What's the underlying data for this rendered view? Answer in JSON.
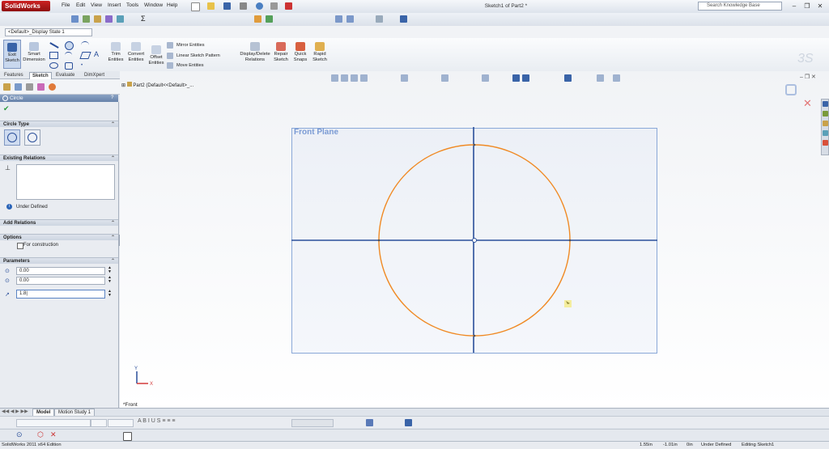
{
  "app": {
    "logo": "SolidWorks",
    "doc_title": "Sketch1 of Part2 *"
  },
  "menu": [
    "File",
    "Edit",
    "View",
    "Insert",
    "Tools",
    "Window",
    "Help"
  ],
  "search": {
    "placeholder": "Search Knowledge Base"
  },
  "config": {
    "display_state": "<Default>_Display State 1"
  },
  "commands": {
    "exit_sketch": [
      "Exit",
      "Sketch"
    ],
    "smart_dimension": [
      "Smart",
      "Dimension"
    ],
    "trim": [
      "Trim",
      "Entities"
    ],
    "convert": [
      "Convert",
      "Entities"
    ],
    "offset": [
      "Offset",
      "Entities"
    ],
    "mirror": "Mirror Entities",
    "linear_pattern": "Linear Sketch Pattern",
    "move": "Move Entities",
    "display_delete": [
      "Display/Delete",
      "Relations"
    ],
    "repair": [
      "Repair",
      "Sketch"
    ],
    "quick_snaps": [
      "Quick",
      "Snaps"
    ],
    "rapid": [
      "Rapid",
      "Sketch"
    ]
  },
  "tabs": [
    "Features",
    "Sketch",
    "Evaluate",
    "DimXpert"
  ],
  "tree": {
    "part": "Part2  (Default<<Default>_..."
  },
  "property_manager": {
    "title": "Circle",
    "circle_type": "Circle Type",
    "existing_relations": "Existing Relations",
    "status": "Under Defined",
    "add_relations": "Add Relations",
    "options": "Options",
    "for_construction": "For construction",
    "parameters": "Parameters",
    "cx": "0.00",
    "cy": "0.00",
    "radius": "1.8|"
  },
  "graphics": {
    "plane_label": "Front Plane",
    "view_label": "*Front"
  },
  "bottom_tabs": [
    "Model",
    "Motion Study 1"
  ],
  "status_bar": {
    "edition": "SolidWorks 2011 x64 Edition",
    "x": "1.55in",
    "y": "-1.01in",
    "z": "0in",
    "defined": "Under Defined",
    "editing": "Editing Sketch1"
  },
  "colors": {
    "circle": "#f08a24",
    "axes": "#2a4f9a",
    "plane_border": "#8aa8d8",
    "header": "#6782aa"
  }
}
